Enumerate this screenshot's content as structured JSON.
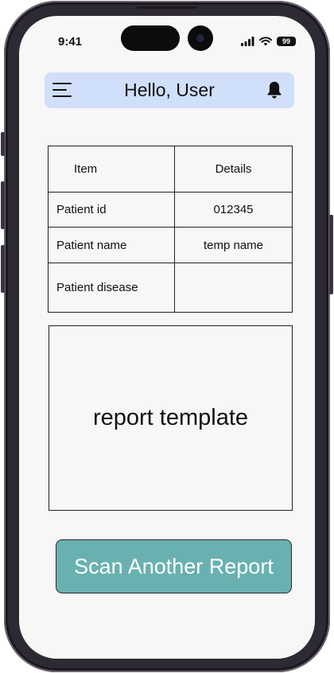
{
  "status_bar": {
    "time": "9:41",
    "battery_level": "99",
    "icons": [
      "signal-icon",
      "wifi-icon",
      "battery-icon"
    ]
  },
  "header": {
    "title": "Hello, User",
    "menu_icon": "hamburger-menu-icon",
    "notification_icon": "bell-icon",
    "background_color": "#d0dffa"
  },
  "table": {
    "columns": [
      "Item",
      "Details"
    ],
    "rows": [
      {
        "item": "Patient id",
        "details": "012345"
      },
      {
        "item": "Patient name",
        "details": "temp name"
      },
      {
        "item": "Patient disease",
        "details": ""
      }
    ]
  },
  "report": {
    "placeholder": "report template"
  },
  "actions": {
    "scan_button_label": "Scan Another Report",
    "scan_button_color": "#69b1b0"
  }
}
